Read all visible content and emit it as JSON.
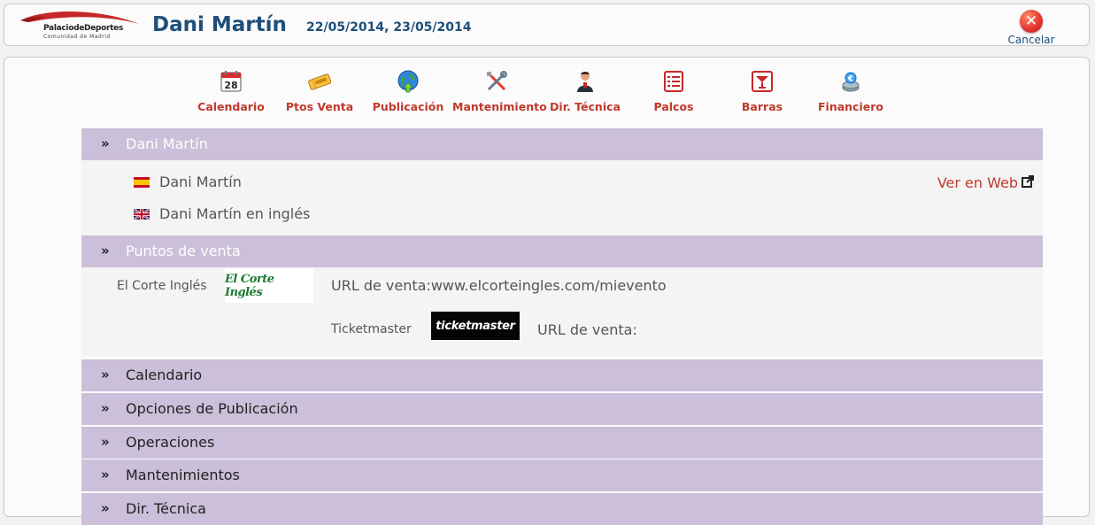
{
  "header": {
    "logo_line1": "PalaciodeDeportes",
    "logo_line2": "Comunidad de Madrid",
    "title": "Dani Martín",
    "dates": "22/05/2014, 23/05/2014",
    "cancel_label": "Cancelar"
  },
  "toolbar": [
    {
      "label": "Calendario",
      "icon": "calendar-icon",
      "calendar_day": "28"
    },
    {
      "label": "Ptos Venta",
      "icon": "ticket-icon"
    },
    {
      "label": "Publicación",
      "icon": "globe-icon"
    },
    {
      "label": "Mantenimiento",
      "icon": "tools-icon"
    },
    {
      "label": "Dir. Técnica",
      "icon": "technician-icon"
    },
    {
      "label": "Palcos",
      "icon": "list-icon"
    },
    {
      "label": "Barras",
      "icon": "cocktail-icon"
    },
    {
      "label": "Financiero",
      "icon": "money-icon"
    }
  ],
  "sections": {
    "event": {
      "title": "Dani Martín",
      "name_es": "Dani Martín",
      "name_en": "Dani Martín en inglés",
      "ver_web": "Ver en Web"
    },
    "puntos_venta": {
      "title": "Puntos de venta",
      "items": [
        {
          "name": "El Corte Inglés",
          "logo_text": "El Corte Inglés",
          "url_label": "URL de venta:",
          "url": "www.elcorteingles.com/mievento"
        },
        {
          "name": "Ticketmaster",
          "logo_text": "ticketmaster",
          "url_label": "URL de venta:",
          "url": ""
        }
      ]
    },
    "collapsed": [
      "Calendario",
      "Opciones de Publicación",
      "Operaciones",
      "Mantenimientos",
      "Dir. Técnica"
    ]
  },
  "colors": {
    "accent_red": "#c0392b",
    "title_blue": "#1f4e79",
    "section_bar": "#cbbfd9"
  }
}
